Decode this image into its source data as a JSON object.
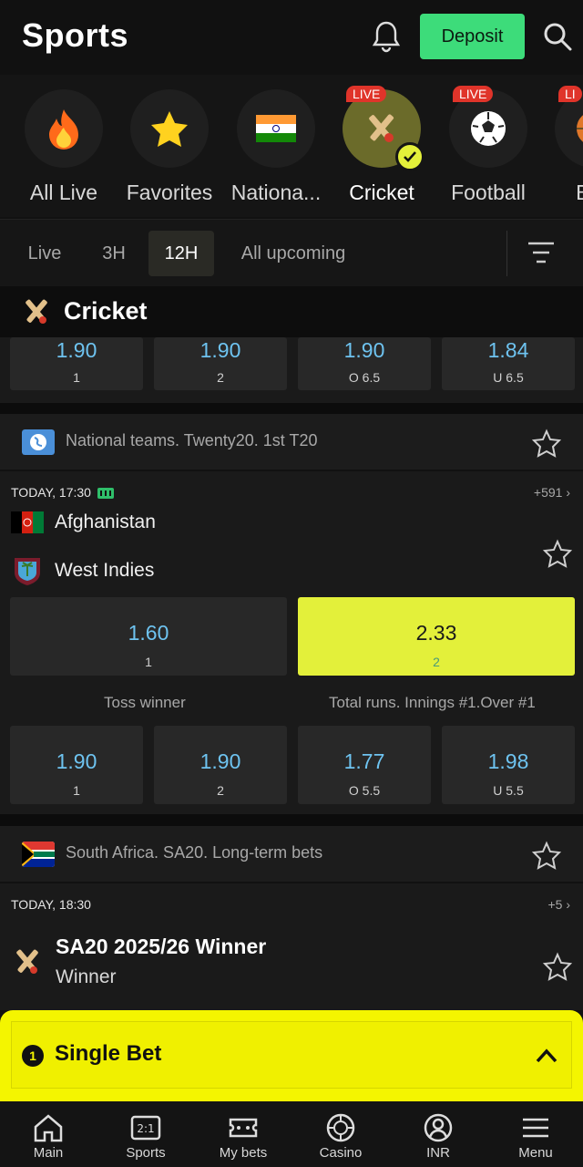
{
  "header": {
    "title": "Sports",
    "deposit_label": "Deposit"
  },
  "categories": [
    {
      "label": "All Live",
      "icon": "fire-icon"
    },
    {
      "label": "Favorites",
      "icon": "star-icon"
    },
    {
      "label": "Nationa...",
      "icon": "india-flag-icon"
    },
    {
      "label": "Cricket",
      "icon": "cricket-icon",
      "live": "LIVE",
      "active": true
    },
    {
      "label": "Football",
      "icon": "football-icon",
      "live": "LIVE"
    },
    {
      "label": "Bas",
      "icon": "basketball-icon",
      "live": "LI"
    }
  ],
  "filters": [
    "Live",
    "3H",
    "12H",
    "All upcoming"
  ],
  "active_filter": "12H",
  "section": {
    "title": "Cricket"
  },
  "partial_odds": [
    {
      "value": "1.90",
      "label": "1"
    },
    {
      "value": "1.90",
      "label": "2"
    },
    {
      "value": "1.90",
      "label": "O 6.5"
    },
    {
      "value": "1.84",
      "label": "U 6.5"
    }
  ],
  "league1": {
    "name": "National teams. Twenty20. 1st T20",
    "time": "TODAY, 17:30",
    "more": "+591",
    "team1": "Afghanistan",
    "team2": "West Indies",
    "main_odds": [
      {
        "value": "1.60",
        "label": "1"
      },
      {
        "value": "2.33",
        "label": "2",
        "selected": true
      }
    ],
    "submarket1": "Toss winner",
    "submarket2": "Total runs. Innings #1.Over #1",
    "sub_odds": [
      {
        "value": "1.90",
        "label": "1"
      },
      {
        "value": "1.90",
        "label": "2"
      },
      {
        "value": "1.77",
        "label": "O 5.5"
      },
      {
        "value": "1.98",
        "label": "U 5.5"
      }
    ]
  },
  "league2": {
    "name": "South Africa. SA20. Long-term bets",
    "time": "TODAY, 18:30",
    "more": "+5",
    "event_title": "SA20 2025/26 Winner",
    "event_subtitle": "Winner"
  },
  "betslip": {
    "count": "1",
    "title": "Single Bet"
  },
  "nav": [
    {
      "label": "Main",
      "icon": "home-icon"
    },
    {
      "label": "Sports",
      "icon": "sports-icon"
    },
    {
      "label": "My bets",
      "icon": "ticket-icon"
    },
    {
      "label": "Casino",
      "icon": "casino-chip-icon"
    },
    {
      "label": "INR",
      "icon": "user-icon"
    },
    {
      "label": "Menu",
      "icon": "menu-icon"
    }
  ],
  "colors": {
    "accent": "#3ddc7a",
    "selected": "#e3f03a",
    "odds": "#6ec3f0",
    "live": "#e0342a"
  }
}
